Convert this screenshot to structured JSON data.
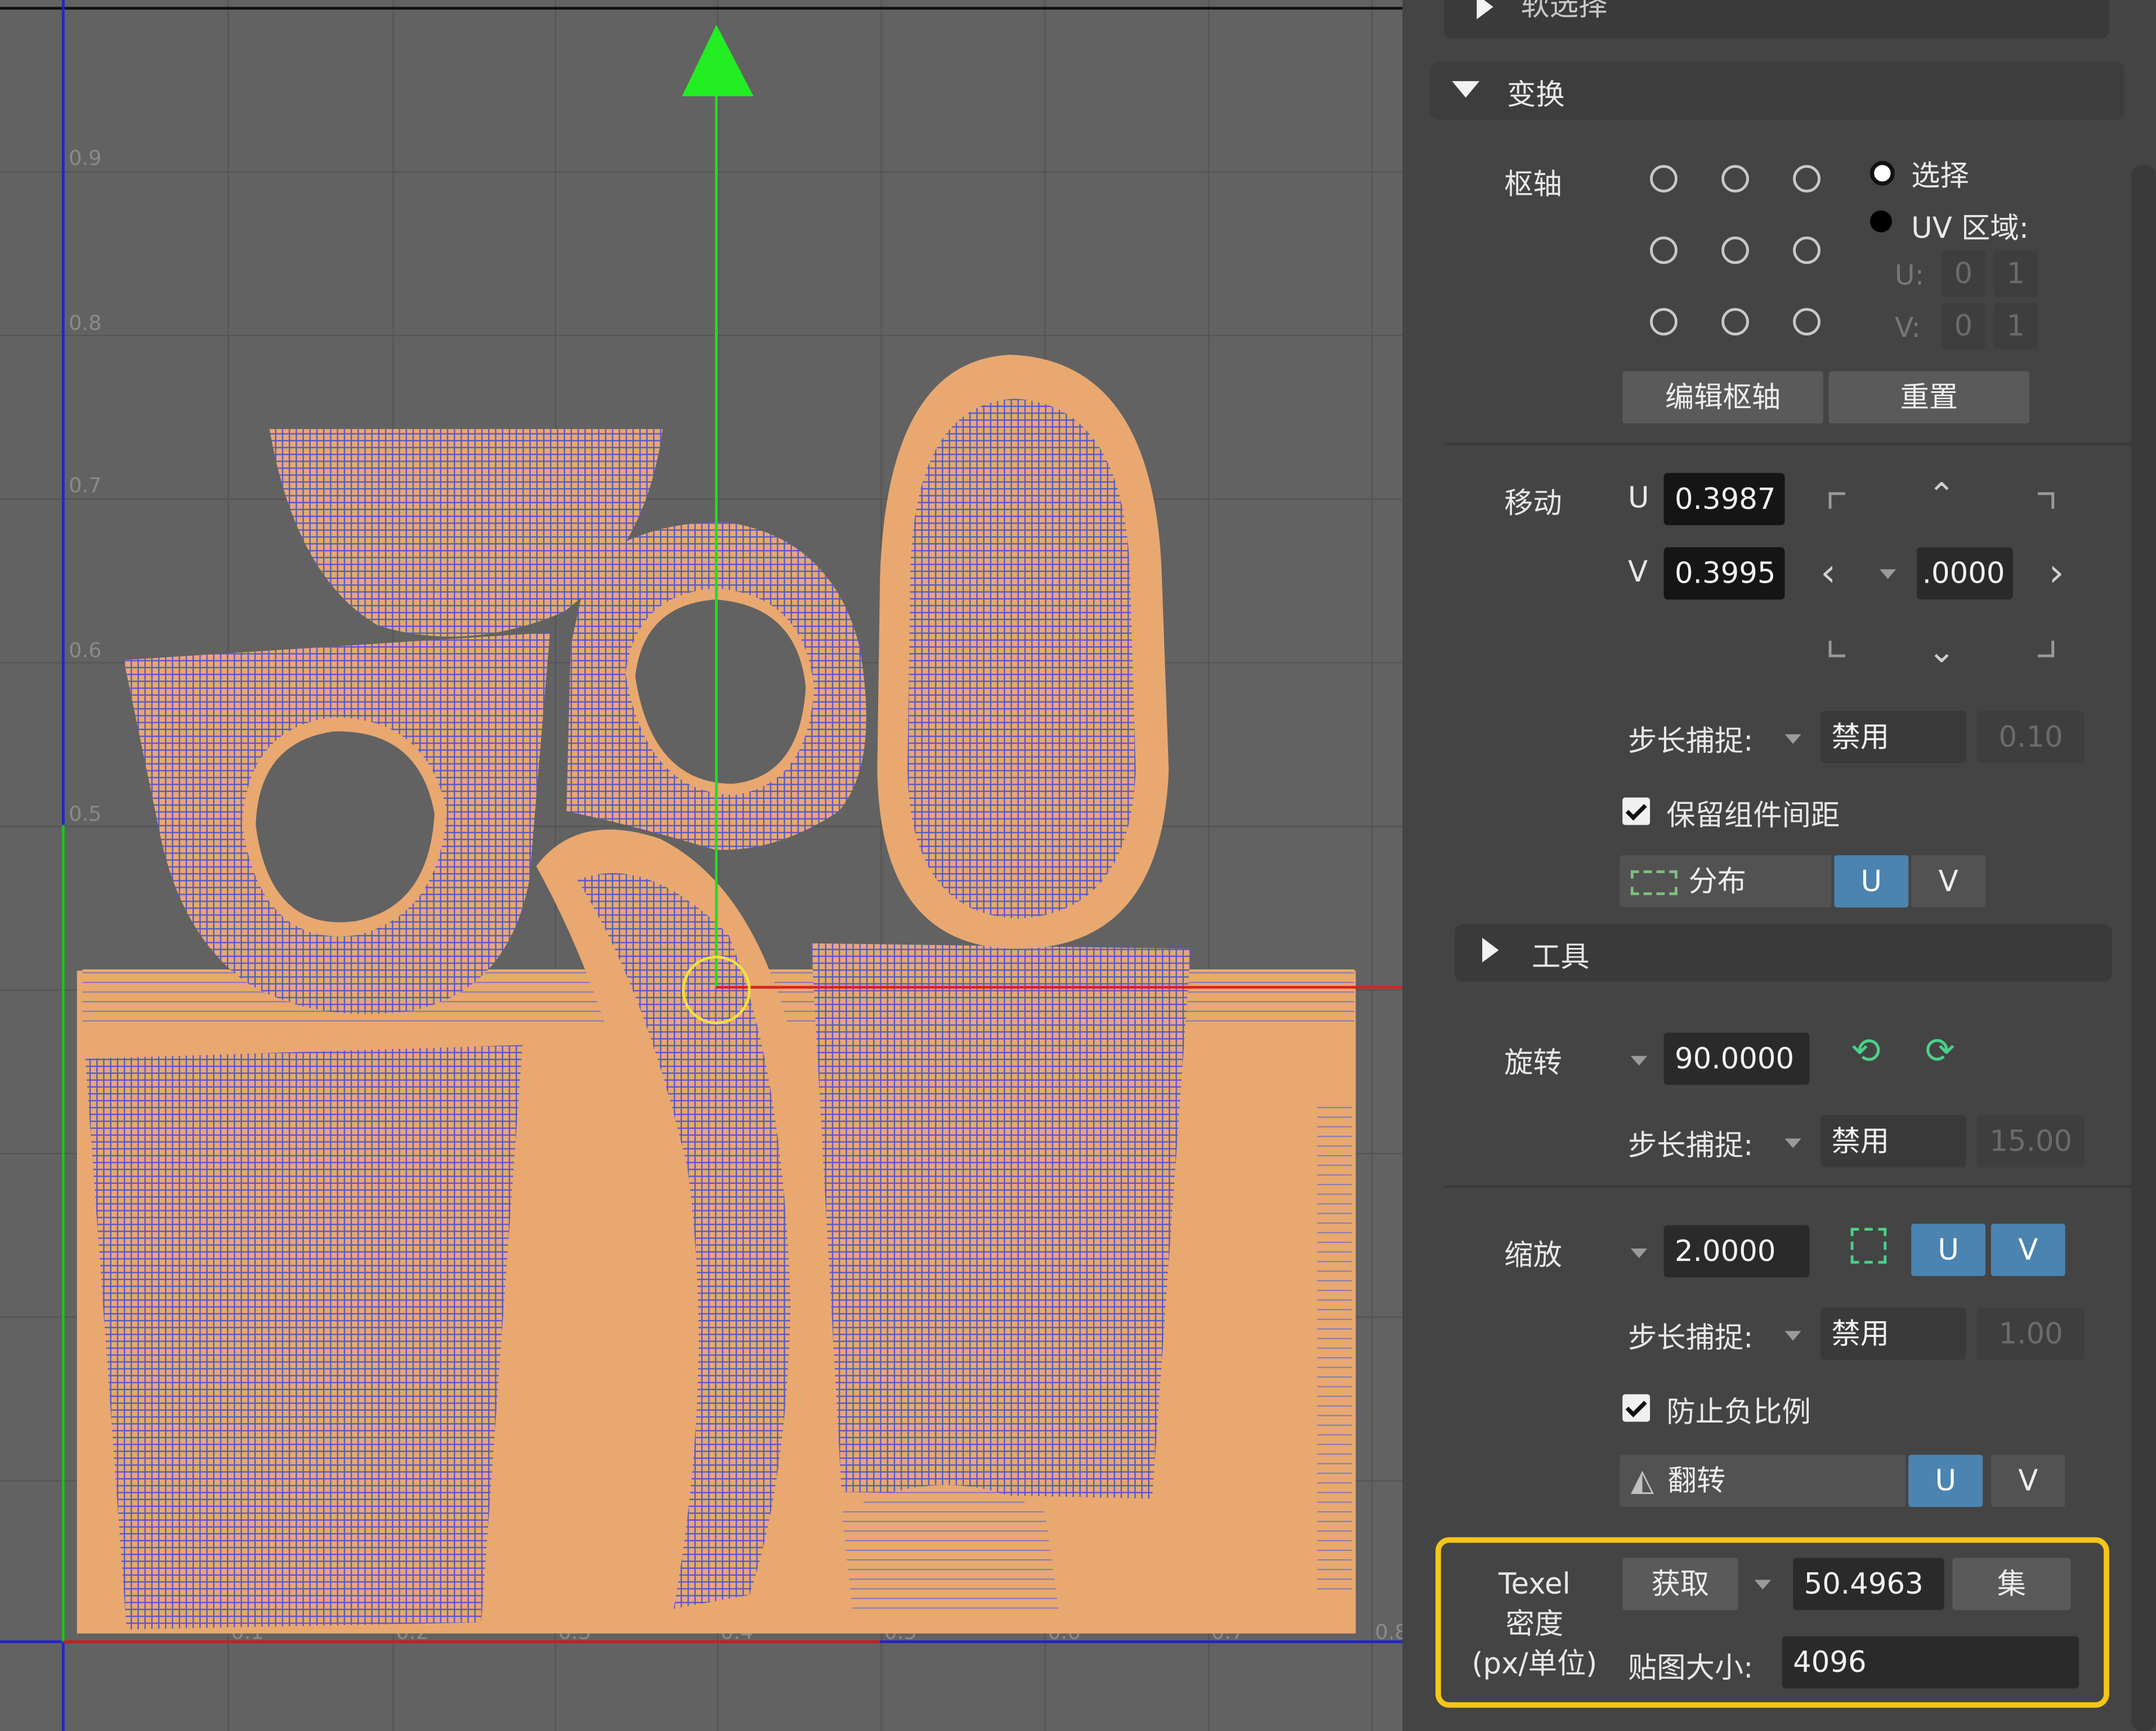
{
  "viewport": {
    "tick_labels_v": [
      "0.9",
      "0.8",
      "0.7",
      "0.6",
      "0.5"
    ],
    "tick_labels_u": [
      "0.1",
      "0.2",
      "0.3",
      "0.4",
      "0.5",
      "0.6",
      "0.7",
      "0.8"
    ],
    "uv_shell_color": "#e8a870",
    "mesh_color": "#5a5ac8"
  },
  "panel": {
    "soft_select": {
      "title": "软选择"
    },
    "transform": {
      "title": "变换"
    },
    "pivot": {
      "label": "枢轴",
      "select_label": "选择",
      "uv_region_label": "UV 区域:",
      "u_label": "U:",
      "u_min": "0",
      "u_max": "1",
      "v_label": "V:",
      "v_min": "0",
      "v_max": "1",
      "edit_pivot": "编辑枢轴",
      "reset": "重置"
    },
    "move": {
      "label": "移动",
      "u_label": "U",
      "u_value": "0.3987",
      "v_label": "V",
      "v_value": "0.3995",
      "step_value": ".0000",
      "snap_label": "步长捕捉:",
      "snap_mode": "禁用",
      "snap_value": "0.10",
      "keep_spacing": "保留组件间距",
      "distribute": "分布",
      "u_btn": "U",
      "v_btn": "V"
    },
    "tools": {
      "title": "工具"
    },
    "rotate": {
      "label": "旋转",
      "value": "90.0000",
      "snap_label": "步长捕捉:",
      "snap_mode": "禁用",
      "snap_value": "15.00"
    },
    "scale": {
      "label": "缩放",
      "value": "2.0000",
      "u_btn": "U",
      "v_btn": "V",
      "snap_label": "步长捕捉:",
      "snap_mode": "禁用",
      "snap_value": "1.00",
      "prevent_negative": "防止负比例",
      "flip": "翻转",
      "flip_u": "U",
      "flip_v": "V"
    },
    "texel": {
      "label_line1": "Texel",
      "label_line2": "密度",
      "label_line3": "(px/单位)",
      "get": "获取",
      "value": "50.4963",
      "set": "集",
      "map_size_label": "贴图大小:",
      "map_size": "4096"
    },
    "highlight_color": "#f5c518"
  }
}
